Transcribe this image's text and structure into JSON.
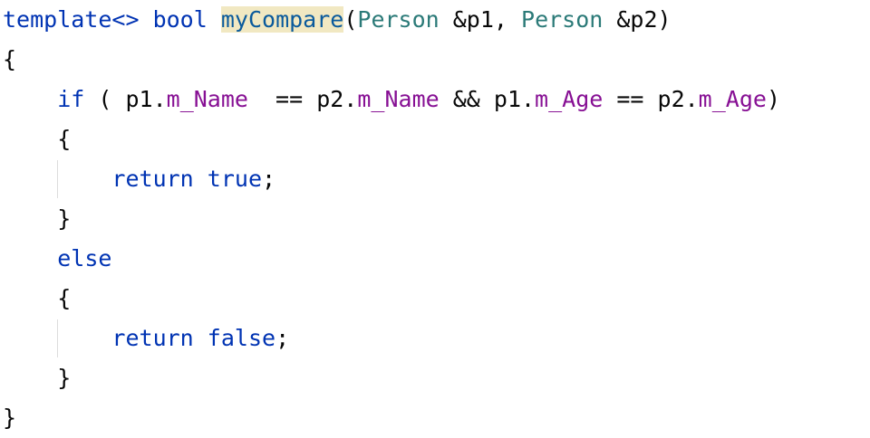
{
  "code": {
    "line1": {
      "t1": "template<>",
      "t2": " ",
      "t3": "bool",
      "t4": " ",
      "t5": "myCompare",
      "t6": "(",
      "t7": "Person",
      "t8": " &p1, ",
      "t9": "Person",
      "t10": " &p2)"
    },
    "line2": {
      "t1": "{"
    },
    "line3": {
      "t0": "    ",
      "t1": "if",
      "t2": " ( p1.",
      "t3": "m_Name",
      "t4": "  == p2.",
      "t5": "m_Name",
      "t6": " && p1.",
      "t7": "m_Age",
      "t8": " == p2.",
      "t9": "m_Age",
      "t10": ")"
    },
    "line4": {
      "t0": "    ",
      "t1": "{"
    },
    "line5": {
      "t0": "        ",
      "t1": "return",
      "t2": " ",
      "t3": "true",
      "t4": ";"
    },
    "line6": {
      "t0": "    ",
      "t1": "}"
    },
    "line7": {
      "t0": "    ",
      "t1": "else"
    },
    "line8": {
      "t0": "    ",
      "t1": "{"
    },
    "line9": {
      "t0": "        ",
      "t1": "return",
      "t2": " ",
      "t3": "false",
      "t4": ";"
    },
    "line10": {
      "t0": "    ",
      "t1": "}"
    },
    "line11": {
      "t1": "}"
    }
  },
  "colors": {
    "keyword": "#0033b3",
    "type": "#2b7a78",
    "function": "#0a5a9c",
    "function_highlight": "#f1e8c2",
    "field": "#871094",
    "text": "#080808",
    "indent_guide": "#dcdcdc"
  }
}
